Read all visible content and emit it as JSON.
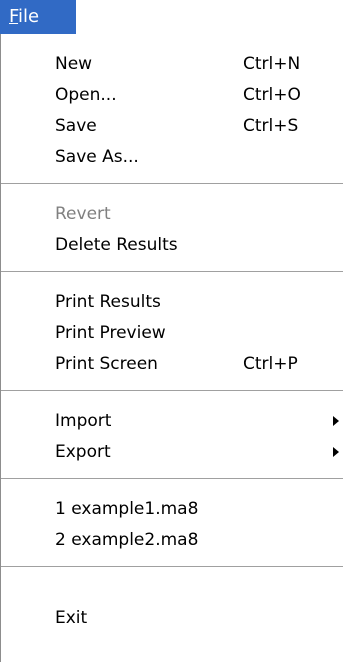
{
  "menubar": {
    "file": {
      "mnemonic": "F",
      "rest": "ile"
    }
  },
  "menu": {
    "new": {
      "label": "New",
      "shortcut": "Ctrl+N"
    },
    "open": {
      "label": "Open...",
      "shortcut": "Ctrl+O"
    },
    "save": {
      "label": "Save",
      "shortcut": "Ctrl+S"
    },
    "save_as": {
      "label": "Save As..."
    },
    "revert": {
      "label": "Revert",
      "enabled": false
    },
    "delete_results": {
      "label": "Delete Results"
    },
    "print_results": {
      "label": "Print Results"
    },
    "print_preview": {
      "label": "Print Preview"
    },
    "print_screen": {
      "label": "Print Screen",
      "shortcut": "Ctrl+P"
    },
    "import": {
      "label": "Import",
      "submenu_icon": "submenu-arrow-icon"
    },
    "export": {
      "label": "Export",
      "submenu_icon": "submenu-arrow-icon"
    },
    "recent_1": {
      "label": "1 example1.ma8"
    },
    "recent_2": {
      "label": "2 example2.ma8"
    },
    "exit": {
      "label": "Exit"
    }
  },
  "colors": {
    "highlight": "#316ac5",
    "disabled_text": "#808080"
  }
}
